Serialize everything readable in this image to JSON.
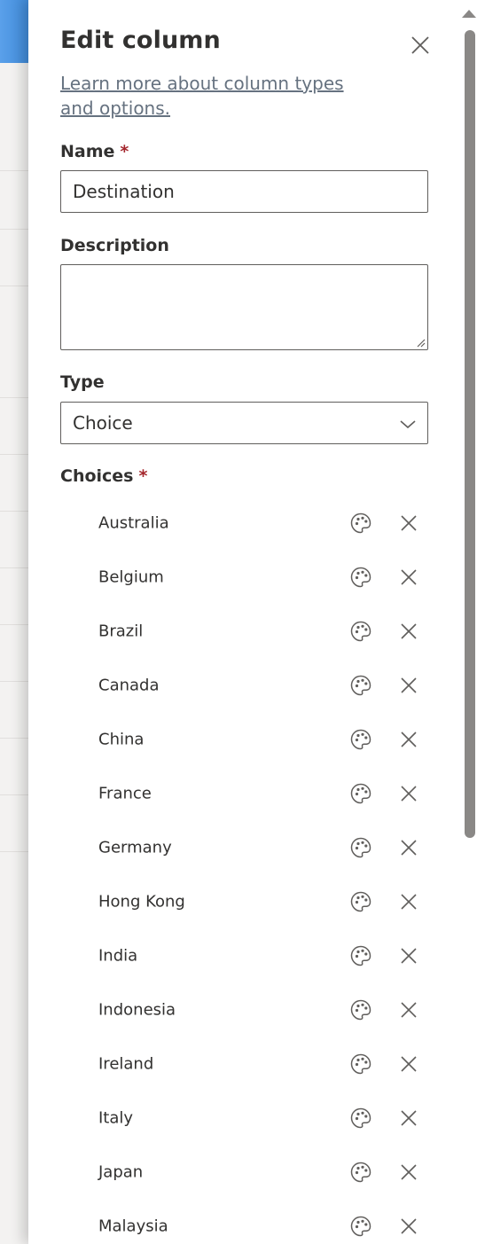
{
  "panel": {
    "title": "Edit column",
    "learn_more_link": "Learn more about column types and options."
  },
  "name_field": {
    "label": "Name",
    "required_marker": "*",
    "value": "Destination"
  },
  "description_field": {
    "label": "Description",
    "value": ""
  },
  "type_field": {
    "label": "Type",
    "selected": "Choice"
  },
  "choices": {
    "label": "Choices",
    "required_marker": "*",
    "items": [
      {
        "label": "Australia"
      },
      {
        "label": "Belgium"
      },
      {
        "label": "Brazil"
      },
      {
        "label": "Canada"
      },
      {
        "label": "China"
      },
      {
        "label": "France"
      },
      {
        "label": "Germany"
      },
      {
        "label": "Hong Kong"
      },
      {
        "label": "India"
      },
      {
        "label": "Indonesia"
      },
      {
        "label": "Ireland"
      },
      {
        "label": "Italy"
      },
      {
        "label": "Japan"
      },
      {
        "label": "Malaysia"
      }
    ]
  },
  "icons": {
    "close": "close-icon",
    "chevron": "chevron-down-icon",
    "palette": "palette-icon",
    "remove": "remove-choice-icon"
  },
  "colors": {
    "required": "#a4262c",
    "link": "#667280",
    "accent": "#4a90e2"
  }
}
